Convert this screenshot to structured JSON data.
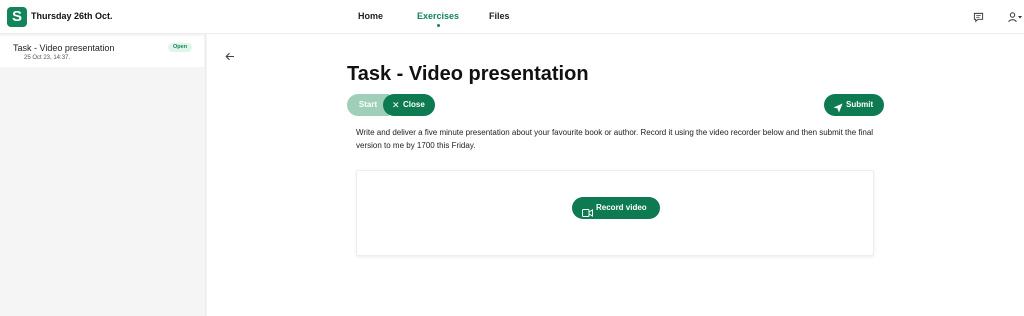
{
  "header": {
    "logo_letter": "S",
    "date": "Thursday 26th Oct.",
    "nav": [
      {
        "label": "Home",
        "active": false
      },
      {
        "label": "Exercises",
        "active": true
      },
      {
        "label": "Files",
        "active": false
      }
    ],
    "icons": [
      "chat-icon",
      "user-icon"
    ]
  },
  "sidebar": {
    "items": [
      {
        "title": "Task - Video presentation",
        "date": "25 Oct 23, 14:37.",
        "badge": "Open"
      }
    ]
  },
  "task": {
    "title": "Task - Video presentation",
    "start_label": "Start",
    "close_label": "Close",
    "submit_label": "Submit",
    "description": "Write and deliver a five minute presentation about your favourite book or author. Record it using the video recorder below and then submit the final version to me by 1700 this Friday.",
    "record_label": "Record video"
  },
  "colors": {
    "accent": "#12855a",
    "button": "#0e7a52",
    "button_disabled": "#9fcfb9",
    "badge_bg": "#e0f5ea"
  }
}
